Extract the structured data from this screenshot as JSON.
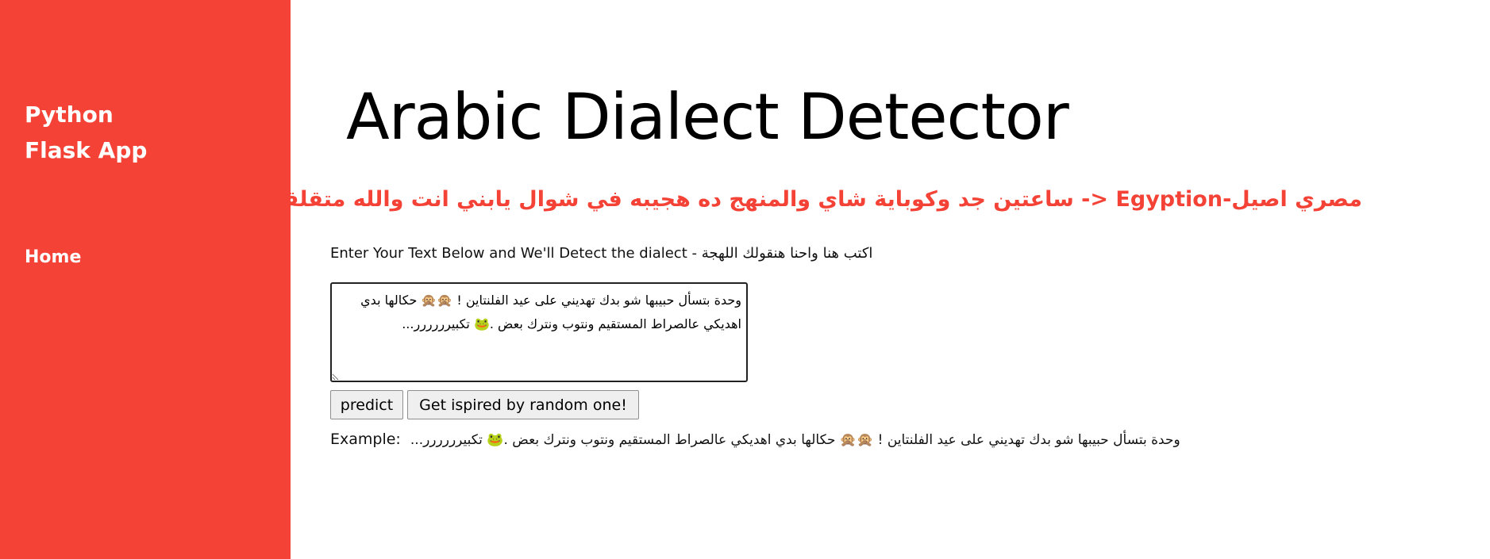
{
  "sidebar": {
    "brand_line1": "Python",
    "brand_line2": "Flask App",
    "nav": [
      {
        "label": "Home"
      }
    ],
    "background_color": "#f44336"
  },
  "main": {
    "title": "Arabic Dialect Detector",
    "result_headline": "مصري اصيل-Egyption <- ساعتين جد وكوباية شاي والمنهج ده هجيبه في شوال يابني انت والله متقلقش!",
    "instruction": "Enter Your Text Below and We'll Detect the dialect - اكتب هنا واحنا هنقولك اللهجة",
    "text_input_value": "وحدة بتسأل حبيبها شو بدك تهديني على عيد الفلنتاين ! 🙊🙊 حكالها بدي اهديكي عالصراط المستقيم ونتوب ونترك بعض .🐸 تكبيرررررر...",
    "predict_button": "predict",
    "random_button": "Get ispired by random one!",
    "example_label": "Example:",
    "example_text": "وحدة بتسأل حبيبها شو بدك تهديني على عيد الفلنتاين ! 🙊🙊 حكالها بدي اهديكي عالصراط المستقيم ونتوب ونترك بعض .🐸 تكبيرررررر...",
    "accent_color": "#f44336"
  }
}
